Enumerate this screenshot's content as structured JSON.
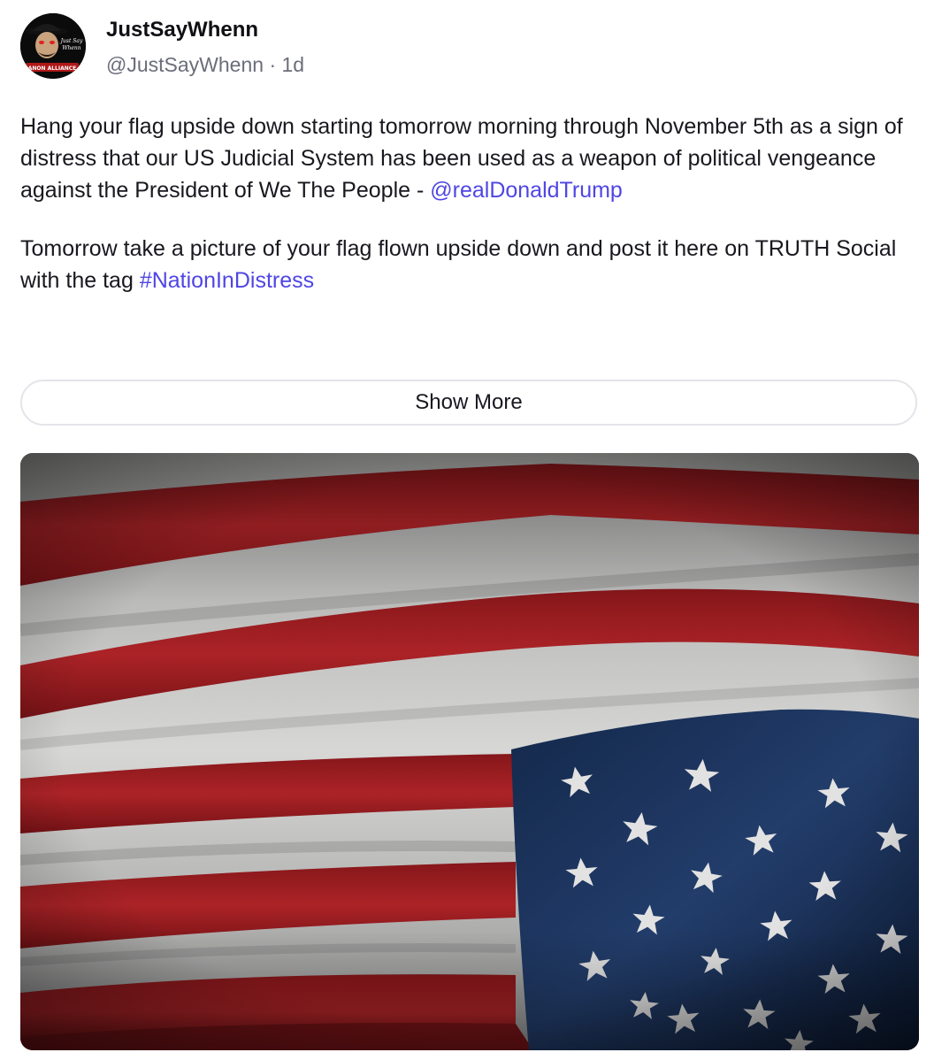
{
  "post": {
    "author": {
      "display_name": "JustSayWhenn",
      "handle": "@JustSayWhenn",
      "separator": "·",
      "timestamp": "1d",
      "avatar_text_top": "Just Say",
      "avatar_text_mid": "Whenn",
      "avatar_text_bottom": "ANON ALLIANCE"
    },
    "paragraph1": {
      "text": "Hang your flag upside down starting tomorrow morning through November 5th as a sign of distress that our US Judicial System has been used as a weapon of political vengeance against the President of We The People - ",
      "mention": "@realDonaldTrump"
    },
    "paragraph2": {
      "text": "Tomorrow take a picture of your flag flown upside down and post it here on TRUTH Social with the tag ",
      "hashtag": "#NationInDistress"
    },
    "show_more_label": "Show More",
    "media": {
      "alt": "American flag",
      "icon": "flag-image"
    },
    "colors": {
      "link": "#4f46e5",
      "muted": "#6b6d7a",
      "flag_red": "#a51e22",
      "flag_white": "#d6d6d6",
      "flag_blue": "#1c3358"
    }
  }
}
